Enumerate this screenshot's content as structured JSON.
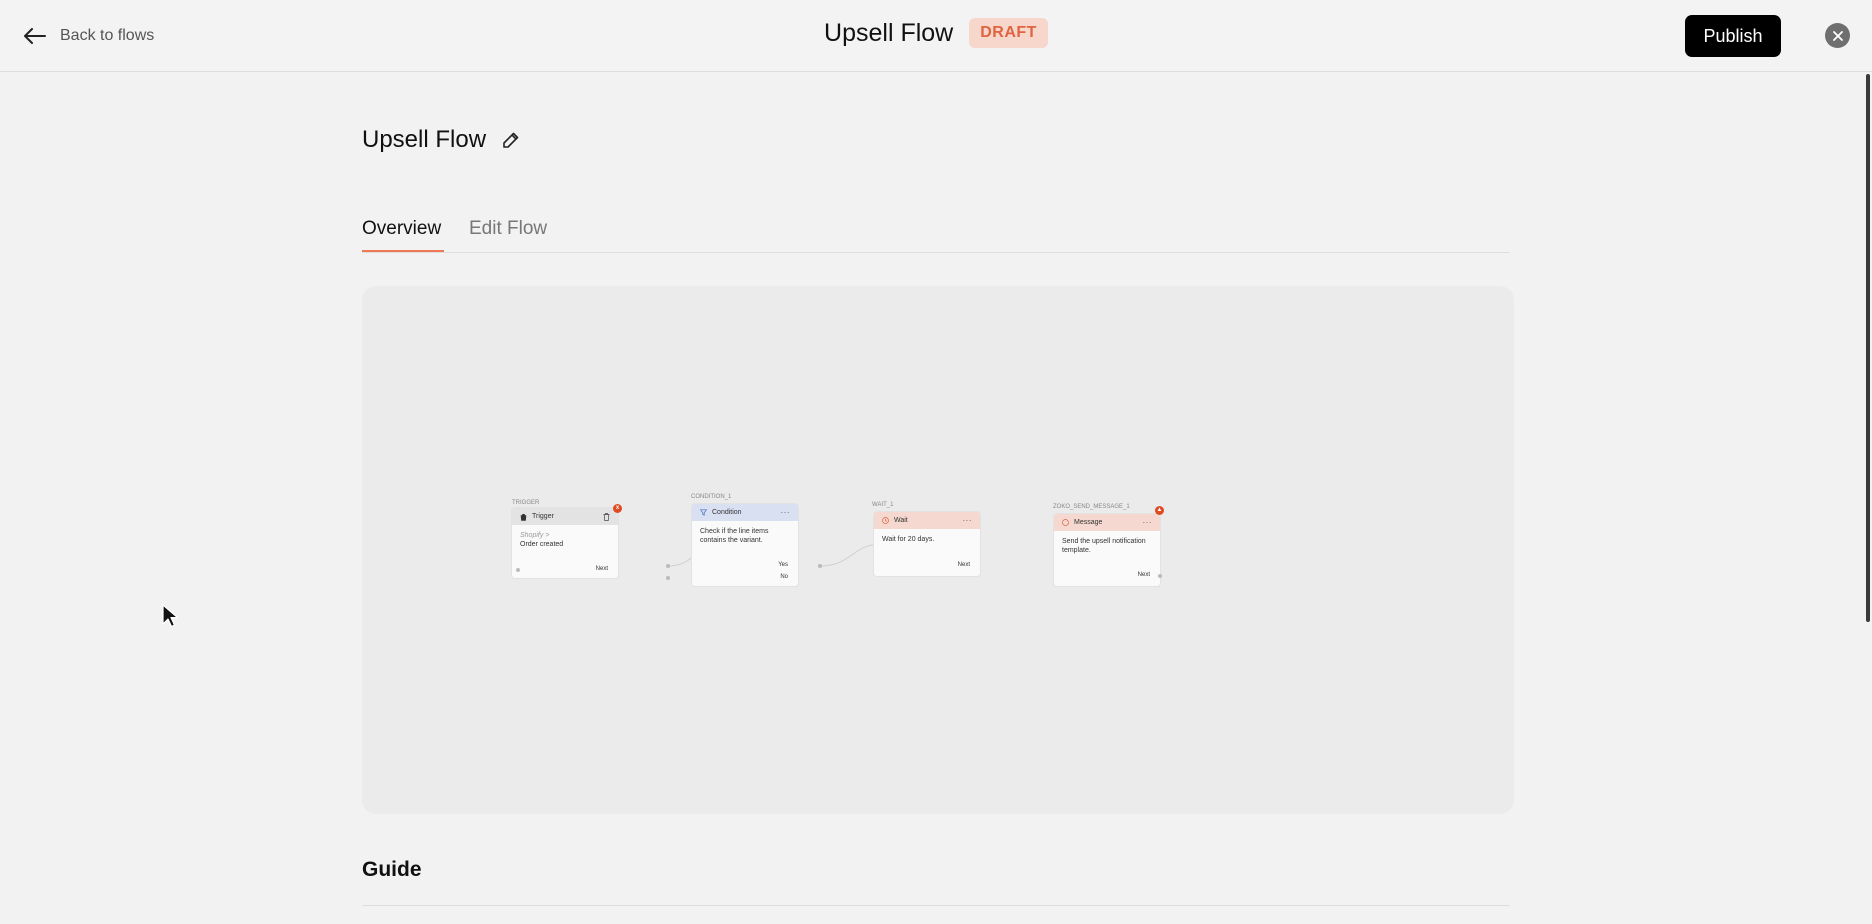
{
  "header": {
    "back_label": "Back to flows",
    "title": "Upsell Flow",
    "status_badge": "DRAFT",
    "publish_label": "Publish"
  },
  "page": {
    "title": "Upsell Flow",
    "tabs": [
      {
        "label": "Overview",
        "active": true
      },
      {
        "label": "Edit Flow",
        "active": false
      }
    ]
  },
  "flow": {
    "nodes": [
      {
        "id_label": "TRIGGER",
        "header": "Trigger",
        "source": "Shopify >",
        "text": "Order created",
        "outputs": [
          "Next"
        ],
        "icon": "shopify-bag-icon",
        "header_color": "#e3e3e3",
        "warning": "x"
      },
      {
        "id_label": "CONDITION_1",
        "header": "Condition",
        "text": "Check if the line items contains the variant.",
        "outputs": [
          "Yes",
          "No"
        ],
        "icon": "filter-icon",
        "header_color": "#d8e0f2"
      },
      {
        "id_label": "WAIT_1",
        "header": "Wait",
        "text": "Wait for 20 days.",
        "outputs": [
          "Next"
        ],
        "icon": "clock-icon",
        "header_color": "#f5d8cf"
      },
      {
        "id_label": "ZOKO_SEND_MESSAGE_1",
        "header": "Message",
        "text": "Send the upsell notification template.",
        "outputs": [
          "Next"
        ],
        "icon": "message-icon",
        "header_color": "#f5d8cf",
        "warning": "▲"
      }
    ],
    "more_glyph": "···"
  },
  "guide": {
    "title": "Guide"
  },
  "colors": {
    "accent": "#ef7a55",
    "badge_bg": "#f7d6cc",
    "badge_text": "#e0643f",
    "publish_bg": "#000000"
  }
}
